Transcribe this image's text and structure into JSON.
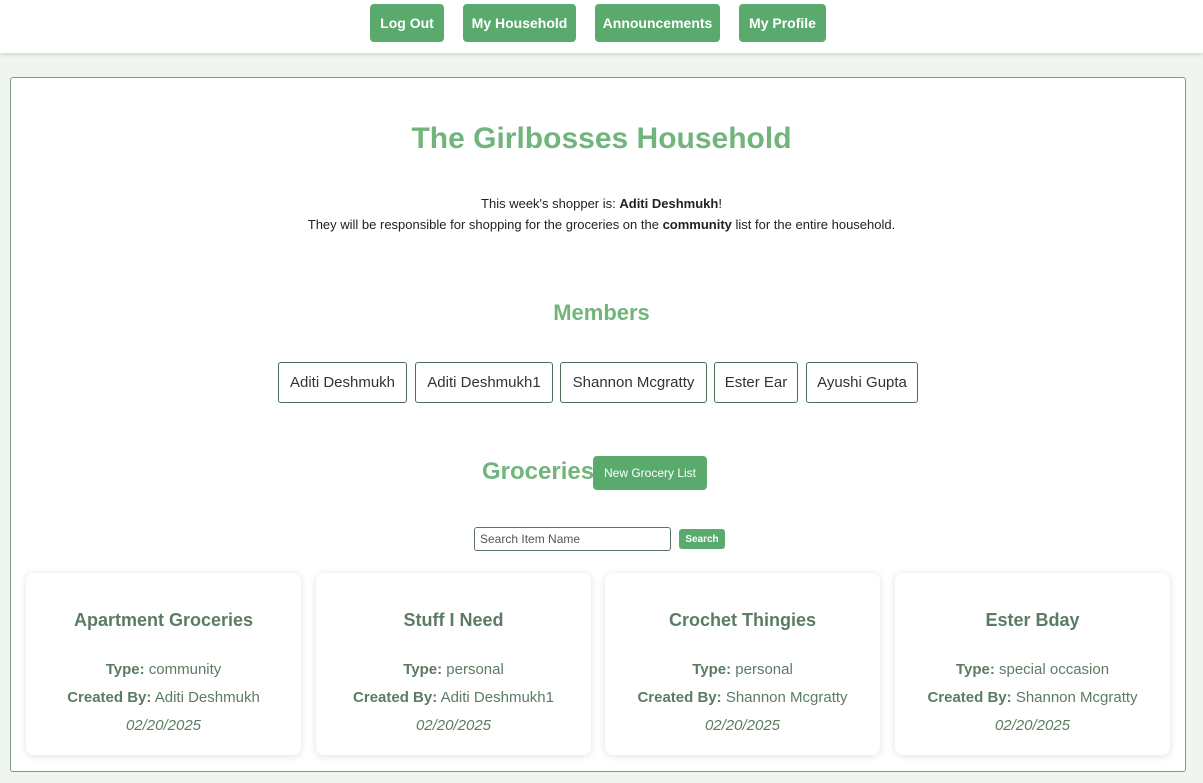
{
  "nav": {
    "logout": "Log Out",
    "household": "My Household",
    "announcements": "Announcements",
    "profile": "My Profile"
  },
  "household": {
    "title": "The Girlbosses Household",
    "shopper_prefix": "This week's shopper is: ",
    "shopper_name": "Aditi Deshmukh",
    "shopper_suffix": "!",
    "responsibility_prefix": "They will be responsible for shopping for the groceries on the ",
    "responsibility_list": "community",
    "responsibility_suffix": " list for the entire household."
  },
  "members": {
    "heading": "Members",
    "items": [
      "Aditi Deshmukh",
      "Aditi Deshmukh1",
      "Shannon Mcgratty",
      "Ester Ear",
      "Ayushi Gupta"
    ]
  },
  "groceries": {
    "heading": "Groceries",
    "new_list_label": "New Grocery List",
    "search_placeholder": "Search Item Name",
    "search_value": "",
    "search_label": "Search",
    "type_label": "Type:",
    "created_label": "Created By:",
    "lists": [
      {
        "name": "Apartment Groceries",
        "type": "community",
        "created_by": "Aditi Deshmukh",
        "date": "02/20/2025"
      },
      {
        "name": "Stuff I Need",
        "type": "personal",
        "created_by": "Aditi Deshmukh1",
        "date": "02/20/2025"
      },
      {
        "name": "Crochet Thingies",
        "type": "personal",
        "created_by": "Shannon Mcgratty",
        "date": "02/20/2025"
      },
      {
        "name": "Ester Bday",
        "type": "special occasion",
        "created_by": "Shannon Mcgratty",
        "date": "02/20/2025"
      }
    ]
  },
  "colors": {
    "accent": "#5aaa6d",
    "heading": "#72b57c",
    "card_text": "#5b7c63"
  }
}
